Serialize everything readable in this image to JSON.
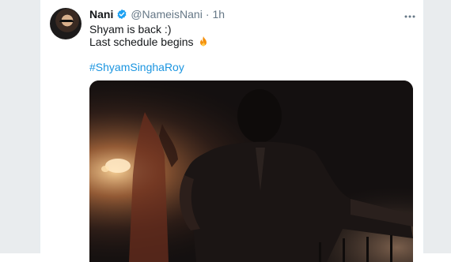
{
  "tweet": {
    "author": {
      "name": "Nani",
      "handle": "@NameisNani",
      "verified": true,
      "avatar_icon": "avatar"
    },
    "time": "1h",
    "separator": "·",
    "text_lines": [
      "Shyam is back :)",
      "Last schedule begins"
    ],
    "emoji": "fire-icon",
    "hashtag": "#ShyamSinghaRoy",
    "more_icon": "more-dots-icon"
  },
  "colors": {
    "text": "#14171a",
    "muted": "#657786",
    "link": "#1b95e0",
    "verified": "#1da1f2",
    "fire": "#f4900c"
  }
}
